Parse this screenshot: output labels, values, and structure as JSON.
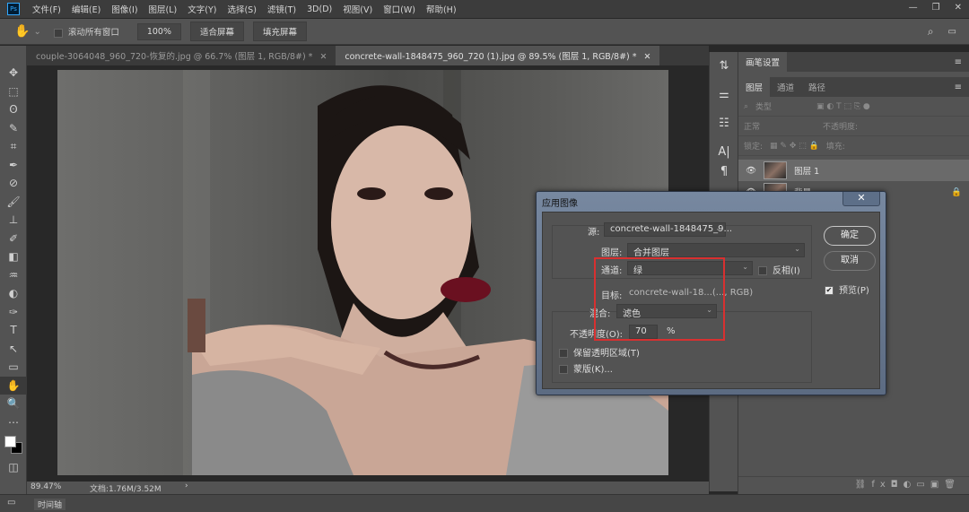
{
  "menubar": {
    "logo": "Ps",
    "items": [
      "文件(F)",
      "编辑(E)",
      "图像(I)",
      "图层(L)",
      "文字(Y)",
      "选择(S)",
      "滤镜(T)",
      "3D(D)",
      "视图(V)",
      "窗口(W)",
      "帮助(H)"
    ],
    "window_controls": [
      "—",
      "❐",
      "✕"
    ]
  },
  "options": {
    "tool_icon": "hand-icon",
    "scroll_all": "滚动所有窗口",
    "zoom": "100%",
    "fit_screen": "适合屏幕",
    "fill_screen": "填充屏幕"
  },
  "tabs": [
    {
      "label": "couple-3064048_960_720-恢复的.jpg @ 66.7% (图层 1, RGB/8#) *",
      "active": false
    },
    {
      "label": "concrete-wall-1848475_960_720 (1).jpg @ 89.5% (图层 1, RGB/8#) *",
      "active": true
    }
  ],
  "tools": [
    "✥",
    "⬚",
    "ʘ",
    "✎",
    "⌗",
    "✒",
    "⊘",
    "🖌",
    "⊥",
    "✐",
    "◧",
    "♒",
    "◐",
    "✑",
    "T",
    "↖",
    "▭",
    "✋",
    "🔍",
    "⋯"
  ],
  "status": {
    "zoom": "89.47%",
    "doc": "文档:1.76M/3.52M",
    "timeline": "时间轴"
  },
  "panel": {
    "brush_settings": "画笔设置",
    "tabs": [
      "图层",
      "通道",
      "路径"
    ],
    "filter": "类型",
    "blend_mode": "正常",
    "opacity_label": "不透明度:",
    "lock_label": "锁定:",
    "fill_label": "填充:",
    "layers": [
      {
        "name": "图层 1",
        "selected": true
      },
      {
        "name": "背景",
        "locked": true
      }
    ]
  },
  "dialog": {
    "title": "应用图像",
    "close": "✕",
    "source_label": "源:",
    "source": "concrete-wall-1848475_9...",
    "layer_label": "图层:",
    "layer": "合并图层",
    "channel_label": "通道:",
    "channel": "绿",
    "invert": "反相(I)",
    "target_label": "目标:",
    "target": "concrete-wall-18...(..., RGB)",
    "blend_label": "混合:",
    "blend": "滤色",
    "opacity_label": "不透明度(O):",
    "opacity": "70",
    "percent": "%",
    "preserve": "保留透明区域(T)",
    "mask": "蒙版(K)...",
    "ok": "确定",
    "cancel": "取消",
    "preview": "预览(P)",
    "preview_checked": true,
    "highlight_color": "#d83030"
  }
}
